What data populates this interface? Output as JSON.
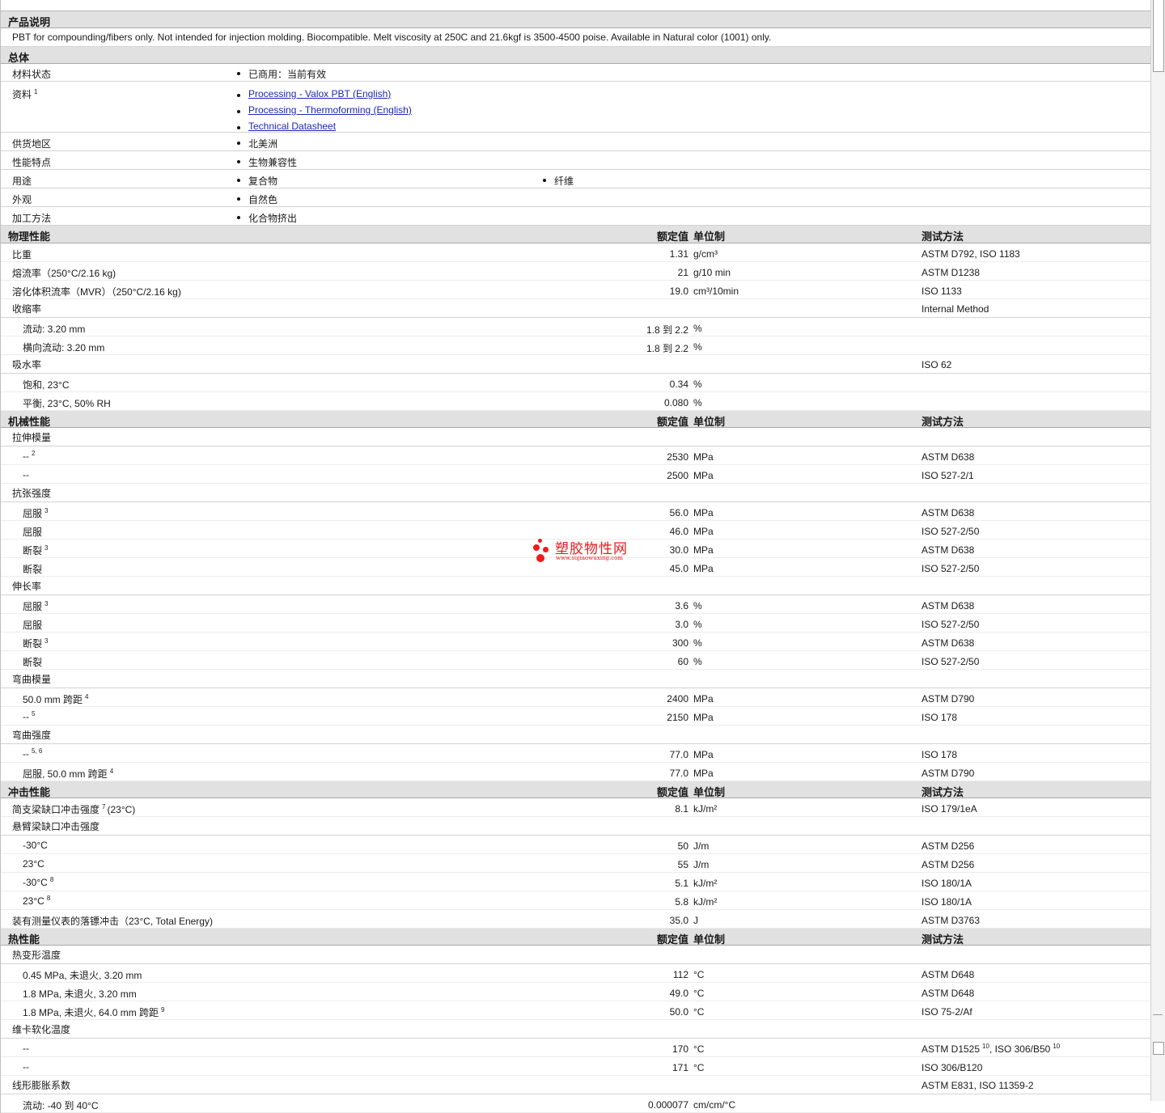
{
  "headers": {
    "value": "额定值",
    "unit": "单位制",
    "test": "测试方法"
  },
  "sections": {
    "desc": {
      "title": "产品说明",
      "text": "PBT for compounding/fibers only. Not intended for injection molding. Biocompatible. Melt viscosity at 250C and 21.6kgf is 3500-4500 poise. Available in Natural color (1001) only."
    },
    "general": {
      "title": "总体",
      "status_label": "材料状态",
      "status_value": "已商用：当前有效",
      "docs_label": "资料",
      "docs_sup": "1",
      "docs": [
        "Processing - Valox PBT (English)",
        "Processing - Thermoforming (English)",
        "Technical Datasheet"
      ],
      "region_label": "供货地区",
      "region_value": "北美洲",
      "features_label": "性能特点",
      "features_value": "生物兼容性",
      "uses_label": "用途",
      "uses_value1": "复合物",
      "uses_value2": "纤维",
      "appearance_label": "外观",
      "appearance_value": "自然色",
      "method_label": "加工方法",
      "method_value": "化合物挤出"
    },
    "physical": {
      "title": "物理性能"
    },
    "mechanical": {
      "title": "机械性能"
    },
    "impact": {
      "title": "冲击性能"
    },
    "thermal": {
      "title": "热性能"
    }
  },
  "physical_rows": [
    {
      "label": "比重",
      "value": "1.31",
      "unit": "g/cm³",
      "test": "ASTM D792, ISO 1183"
    },
    {
      "label": "熔流率（250°C/2.16 kg)",
      "value": "21",
      "unit": "g/10 min",
      "test": "ASTM D1238"
    },
    {
      "label": "溶化体积流率（MVR）（250°C/2.16 kg)",
      "value": "19.0",
      "unit": "cm³/10min",
      "test": "ISO 1133"
    },
    {
      "label": "收缩率",
      "test": "Internal Method"
    },
    {
      "label": "流动: 3.20 mm",
      "value": "1.8 到  2.2",
      "unit": "%"
    },
    {
      "label": "横向流动: 3.20 mm",
      "value": "1.8 到  2.2",
      "unit": "%"
    },
    {
      "label": "吸水率",
      "test": "ISO 62"
    },
    {
      "label": "饱和, 23°C",
      "value": "0.34",
      "unit": "%"
    },
    {
      "label": "平衡, 23°C, 50% RH",
      "value": "0.080",
      "unit": "%"
    }
  ],
  "mechanical_rows": [
    {
      "label": "拉伸模量"
    },
    {
      "label": "--",
      "sup": "2",
      "value": "2530",
      "unit": "MPa",
      "test": "ASTM D638"
    },
    {
      "label": "--",
      "value": "2500",
      "unit": "MPa",
      "test": "ISO 527-2/1"
    },
    {
      "label": "抗张强度"
    },
    {
      "label": "屈服",
      "sup": "3",
      "value": "56.0",
      "unit": "MPa",
      "test": "ASTM D638"
    },
    {
      "label": "屈服",
      "value": "46.0",
      "unit": "MPa",
      "test": "ISO 527-2/50"
    },
    {
      "label": "断裂",
      "sup": "3",
      "value": "30.0",
      "unit": "MPa",
      "test": "ASTM D638"
    },
    {
      "label": "断裂",
      "value": "45.0",
      "unit": "MPa",
      "test": "ISO 527-2/50"
    },
    {
      "label": "伸长率"
    },
    {
      "label": "屈服",
      "sup": "3",
      "value": "3.6",
      "unit": "%",
      "test": "ASTM D638"
    },
    {
      "label": "屈服",
      "value": "3.0",
      "unit": "%",
      "test": "ISO 527-2/50"
    },
    {
      "label": "断裂",
      "sup": "3",
      "value": "300",
      "unit": "%",
      "test": "ASTM D638"
    },
    {
      "label": "断裂",
      "value": "60",
      "unit": "%",
      "test": "ISO 527-2/50"
    },
    {
      "label": "弯曲模量"
    },
    {
      "label": "50.0 mm 跨距",
      "sup": "4",
      "value": "2400",
      "unit": "MPa",
      "test": "ASTM D790"
    },
    {
      "label": "--",
      "sup": "5",
      "value": "2150",
      "unit": "MPa",
      "test": "ISO 178"
    },
    {
      "label": "弯曲强度"
    },
    {
      "label": "--",
      "sup": "5, 6",
      "value": "77.0",
      "unit": "MPa",
      "test": "ISO 178"
    },
    {
      "label": "屈服, 50.0 mm 跨距",
      "sup": "4",
      "value": "77.0",
      "unit": "MPa",
      "test": "ASTM D790"
    }
  ],
  "impact_rows": [
    {
      "label": "简支梁缺口冲击强度",
      "sup": "7",
      "suffix": "(23°C)",
      "value": "8.1",
      "unit": "kJ/m²",
      "test": "ISO 179/1eA"
    },
    {
      "label": "悬臂梁缺口冲击强度"
    },
    {
      "label": "-30°C",
      "value": "50",
      "unit": "J/m",
      "test": "ASTM D256"
    },
    {
      "label": "23°C",
      "value": "55",
      "unit": "J/m",
      "test": "ASTM D256"
    },
    {
      "label": "-30°C",
      "sup": "8",
      "value": "5.1",
      "unit": "kJ/m²",
      "test": "ISO 180/1A"
    },
    {
      "label": "23°C",
      "sup": "8",
      "value": "5.8",
      "unit": "kJ/m²",
      "test": "ISO 180/1A"
    },
    {
      "label": "装有测量仪表的落镖冲击（23°C, Total Energy)",
      "value": "35.0",
      "unit": "J",
      "test": "ASTM D3763"
    }
  ],
  "thermal_rows": [
    {
      "label": "热变形温度"
    },
    {
      "label": "0.45 MPa, 未退火, 3.20 mm",
      "value": "112",
      "unit": "°C",
      "test": "ASTM D648"
    },
    {
      "label": "1.8 MPa, 未退火, 3.20 mm",
      "value": "49.0",
      "unit": "°C",
      "test": "ASTM D648"
    },
    {
      "label": "1.8 MPa, 未退火, 64.0 mm 跨距",
      "sup": "9",
      "value": "50.0",
      "unit": "°C",
      "test": "ISO 75-2/Af"
    },
    {
      "label": "维卡软化温度"
    },
    {
      "label": "--",
      "value": "170",
      "unit": "°C",
      "test": "ASTM D1525",
      "test_sup": "10",
      "test2": ", ISO 306/B50",
      "test2_sup": "10"
    },
    {
      "label": "--",
      "value": "171",
      "unit": "°C",
      "test": "ISO 306/B120"
    },
    {
      "label": "线形膨胀系数",
      "test": "ASTM E831, ISO 11359-2"
    },
    {
      "label": "流动: -40 到  40°C",
      "value": "0.000077",
      "unit": "cm/cm/°C"
    }
  ],
  "watermark": {
    "name": "塑胶物性网",
    "url": "www.sujiaowuxing.com",
    "color": "#e51c1c"
  },
  "colors": {
    "section_bg": "#e1e1e1",
    "link": "#1c28b4",
    "row_border": "#d3d3d3"
  }
}
